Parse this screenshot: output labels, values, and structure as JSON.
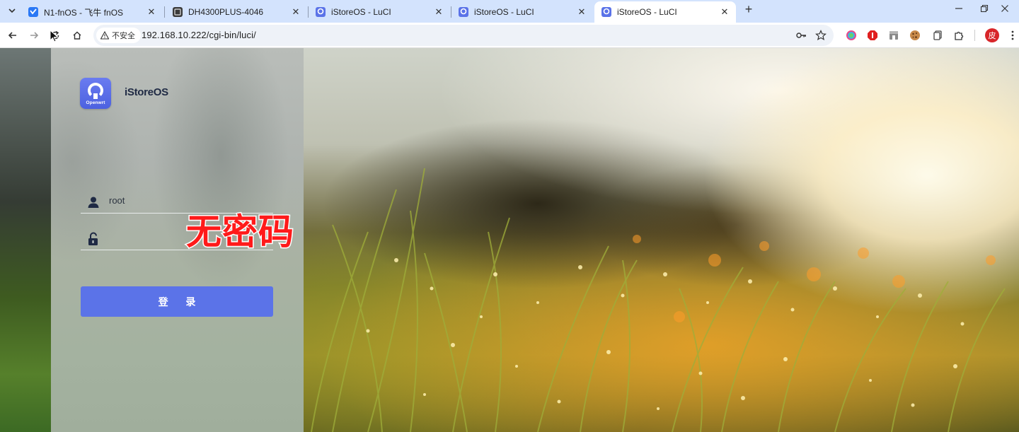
{
  "browser": {
    "tabs": [
      {
        "title": "N1-fnOS - 飞牛 fnOS",
        "favicon": "fnos-icon",
        "active": false
      },
      {
        "title": "DH4300PLUS-4046",
        "favicon": "nas-icon",
        "active": false
      },
      {
        "title": "iStoreOS - LuCI",
        "favicon": "istoreos-icon",
        "active": false
      },
      {
        "title": "iStoreOS - LuCI",
        "favicon": "istoreos-icon",
        "active": false
      },
      {
        "title": "iStoreOS - LuCI",
        "favicon": "istoreos-icon",
        "active": true
      }
    ],
    "security_label": "不安全",
    "url": "192.168.10.222/cgi-bin/luci/",
    "extensions": [
      "chromatic-icon",
      "adblock-icon",
      "store-icon",
      "cookie-icon",
      "copy-icon",
      "puzzle-icon",
      "profile-avatar"
    ],
    "profile_initial": "皮"
  },
  "login": {
    "brand_name": "iStoreOS",
    "logo_label": "Openwrt",
    "username": "root",
    "password_placeholder": "",
    "submit_label": "登 录"
  },
  "overlay": {
    "caption": "无密码"
  },
  "colors": {
    "accent": "#5b73e8",
    "caption": "#ff1a1a",
    "tabstrip": "#d3e3fd"
  }
}
